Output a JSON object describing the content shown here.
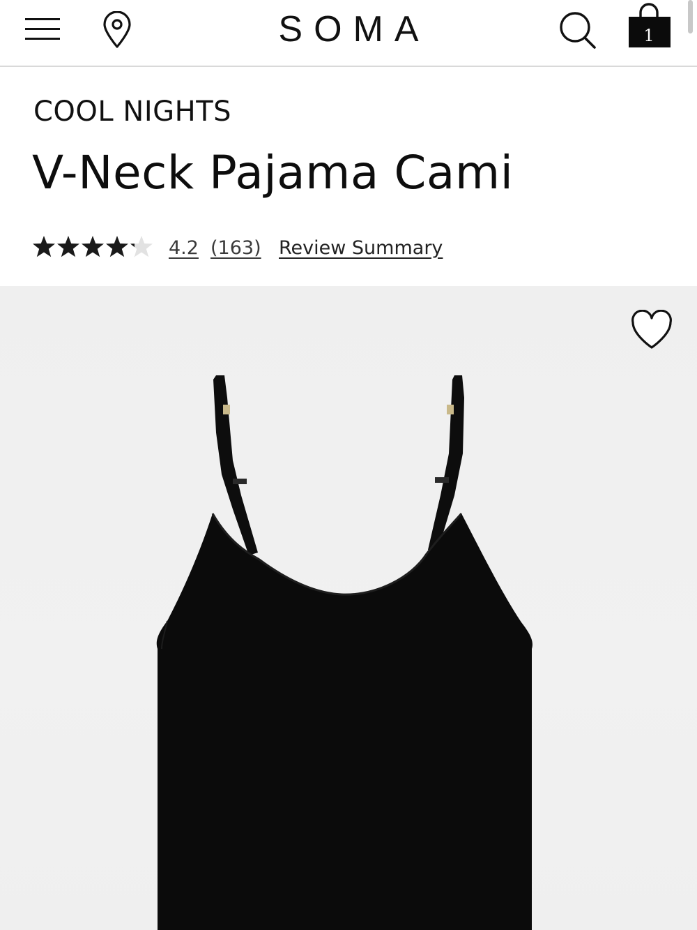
{
  "header": {
    "logo_text": "SOMA",
    "menu_icon": "hamburger-menu-icon",
    "location_icon": "map-pin-icon",
    "search_icon": "search-icon",
    "bag_icon": "shopping-bag-icon",
    "bag_count": "1"
  },
  "product": {
    "collection": "COOL NIGHTS",
    "title": "V-Neck Pajama Cami",
    "rating": {
      "stars_filled": 4.2,
      "stars_total": 5,
      "value": "4.2",
      "count": "(163)",
      "summary_link": "Review Summary"
    },
    "image": {
      "wishlist_icon": "heart-outline-icon",
      "background_color": "#efefef",
      "garment_color": "#0b0b0b"
    }
  },
  "colors": {
    "text": "#111111",
    "divider": "#d9d9d9",
    "star_filled": "#1a1a1a",
    "star_empty": "#e2e2e2"
  }
}
